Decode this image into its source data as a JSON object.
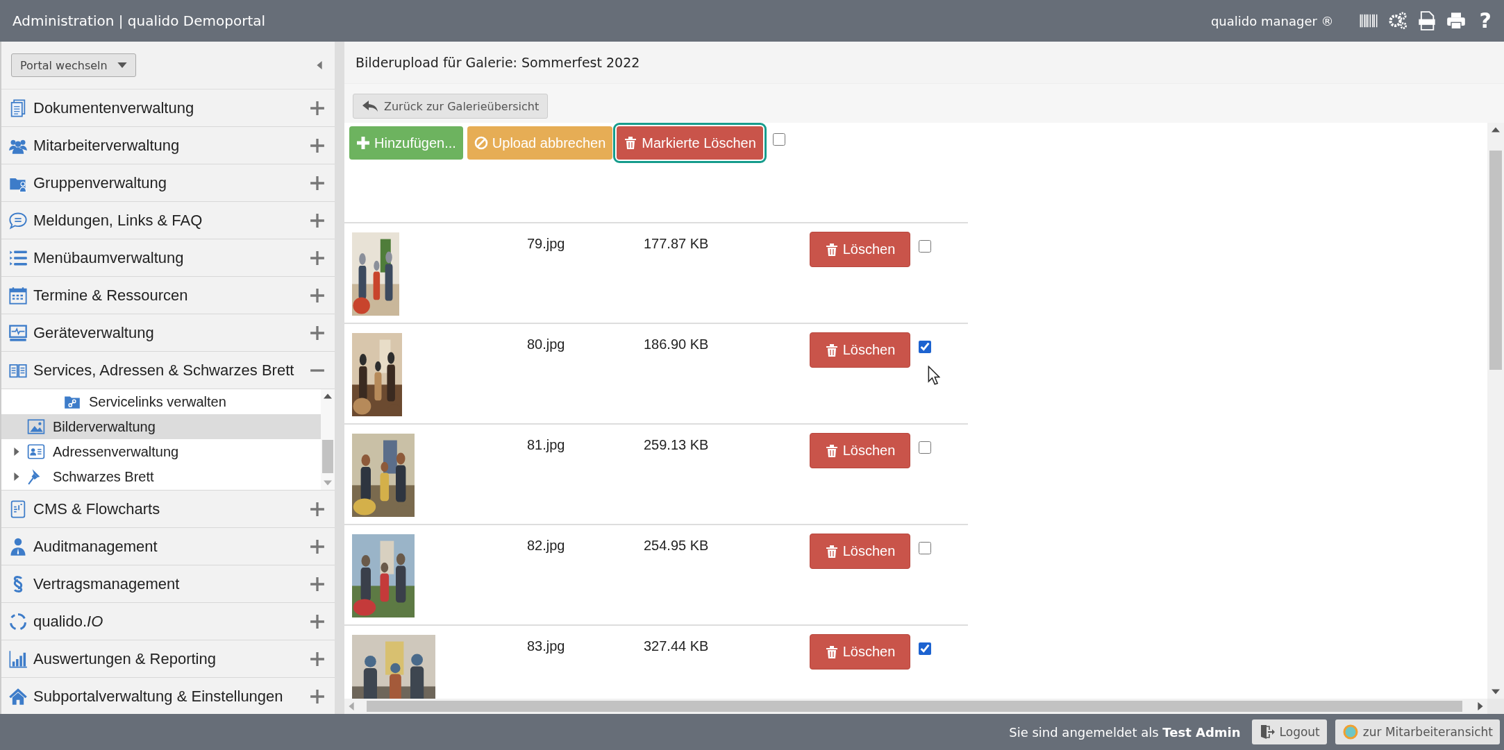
{
  "header": {
    "title": "Administration | qualido Demoportal",
    "product": "qualido manager ®",
    "help_glyph": "?"
  },
  "sidebar": {
    "portal_select": "Portal wechseln",
    "items": [
      {
        "label": "Dokumentenverwaltung",
        "expanded": false
      },
      {
        "label": "Mitarbeiterverwaltung",
        "expanded": false
      },
      {
        "label": "Gruppenverwaltung",
        "expanded": false
      },
      {
        "label": "Meldungen, Links & FAQ",
        "expanded": false
      },
      {
        "label": "Menübaumverwaltung",
        "expanded": false
      },
      {
        "label": "Termine & Ressourcen",
        "expanded": false
      },
      {
        "label": "Geräteverwaltung",
        "expanded": false
      },
      {
        "label": "Services, Adressen & Schwarzes Brett",
        "expanded": true,
        "children": [
          {
            "label": "Servicelinks verwalten",
            "kind": "nested",
            "expandable": false,
            "selected": false
          },
          {
            "label": "Bilderverwaltung",
            "kind": "top",
            "expandable": false,
            "selected": true
          },
          {
            "label": "Adressenverwaltung",
            "kind": "top",
            "expandable": true,
            "selected": false
          },
          {
            "label": "Schwarzes Brett",
            "kind": "top",
            "expandable": true,
            "selected": false
          }
        ]
      },
      {
        "label": "CMS & Flowcharts",
        "expanded": false
      },
      {
        "label": "Auditmanagement",
        "expanded": false
      },
      {
        "label": "Vertragsmanagement",
        "expanded": false
      },
      {
        "label": "qualido.*IO*",
        "expanded": false
      },
      {
        "label": "Auswertungen & Reporting",
        "expanded": false
      },
      {
        "label": "Subportalverwaltung & Einstellungen",
        "expanded": false
      }
    ]
  },
  "page": {
    "title": "Bilderupload für Galerie: Sommerfest 2022",
    "back_button": "Zurück zur Galerieübersicht",
    "toolbar": [
      {
        "label": "Hinzufügen...",
        "kind": "add",
        "focused": false
      },
      {
        "label": "Upload abbrechen",
        "kind": "cancel",
        "focused": false
      },
      {
        "label": "Markierte Löschen",
        "kind": "delete",
        "focused": true
      }
    ],
    "select_all_checked": false,
    "files": [
      {
        "name": "79.jpg",
        "size": "177.87 KB",
        "delete_label": "Löschen",
        "checked": false
      },
      {
        "name": "80.jpg",
        "size": "186.90 KB",
        "delete_label": "Löschen",
        "checked": true
      },
      {
        "name": "81.jpg",
        "size": "259.13 KB",
        "delete_label": "Löschen",
        "checked": false
      },
      {
        "name": "82.jpg",
        "size": "254.95 KB",
        "delete_label": "Löschen",
        "checked": false
      },
      {
        "name": "83.jpg",
        "size": "327.44 KB",
        "delete_label": "Löschen",
        "checked": true
      }
    ]
  },
  "footer": {
    "login_text": "Sie sind angemeldet als **Test Admin**",
    "logout": "Logout",
    "staff_view": "zur Mitarbeiteransicht"
  }
}
